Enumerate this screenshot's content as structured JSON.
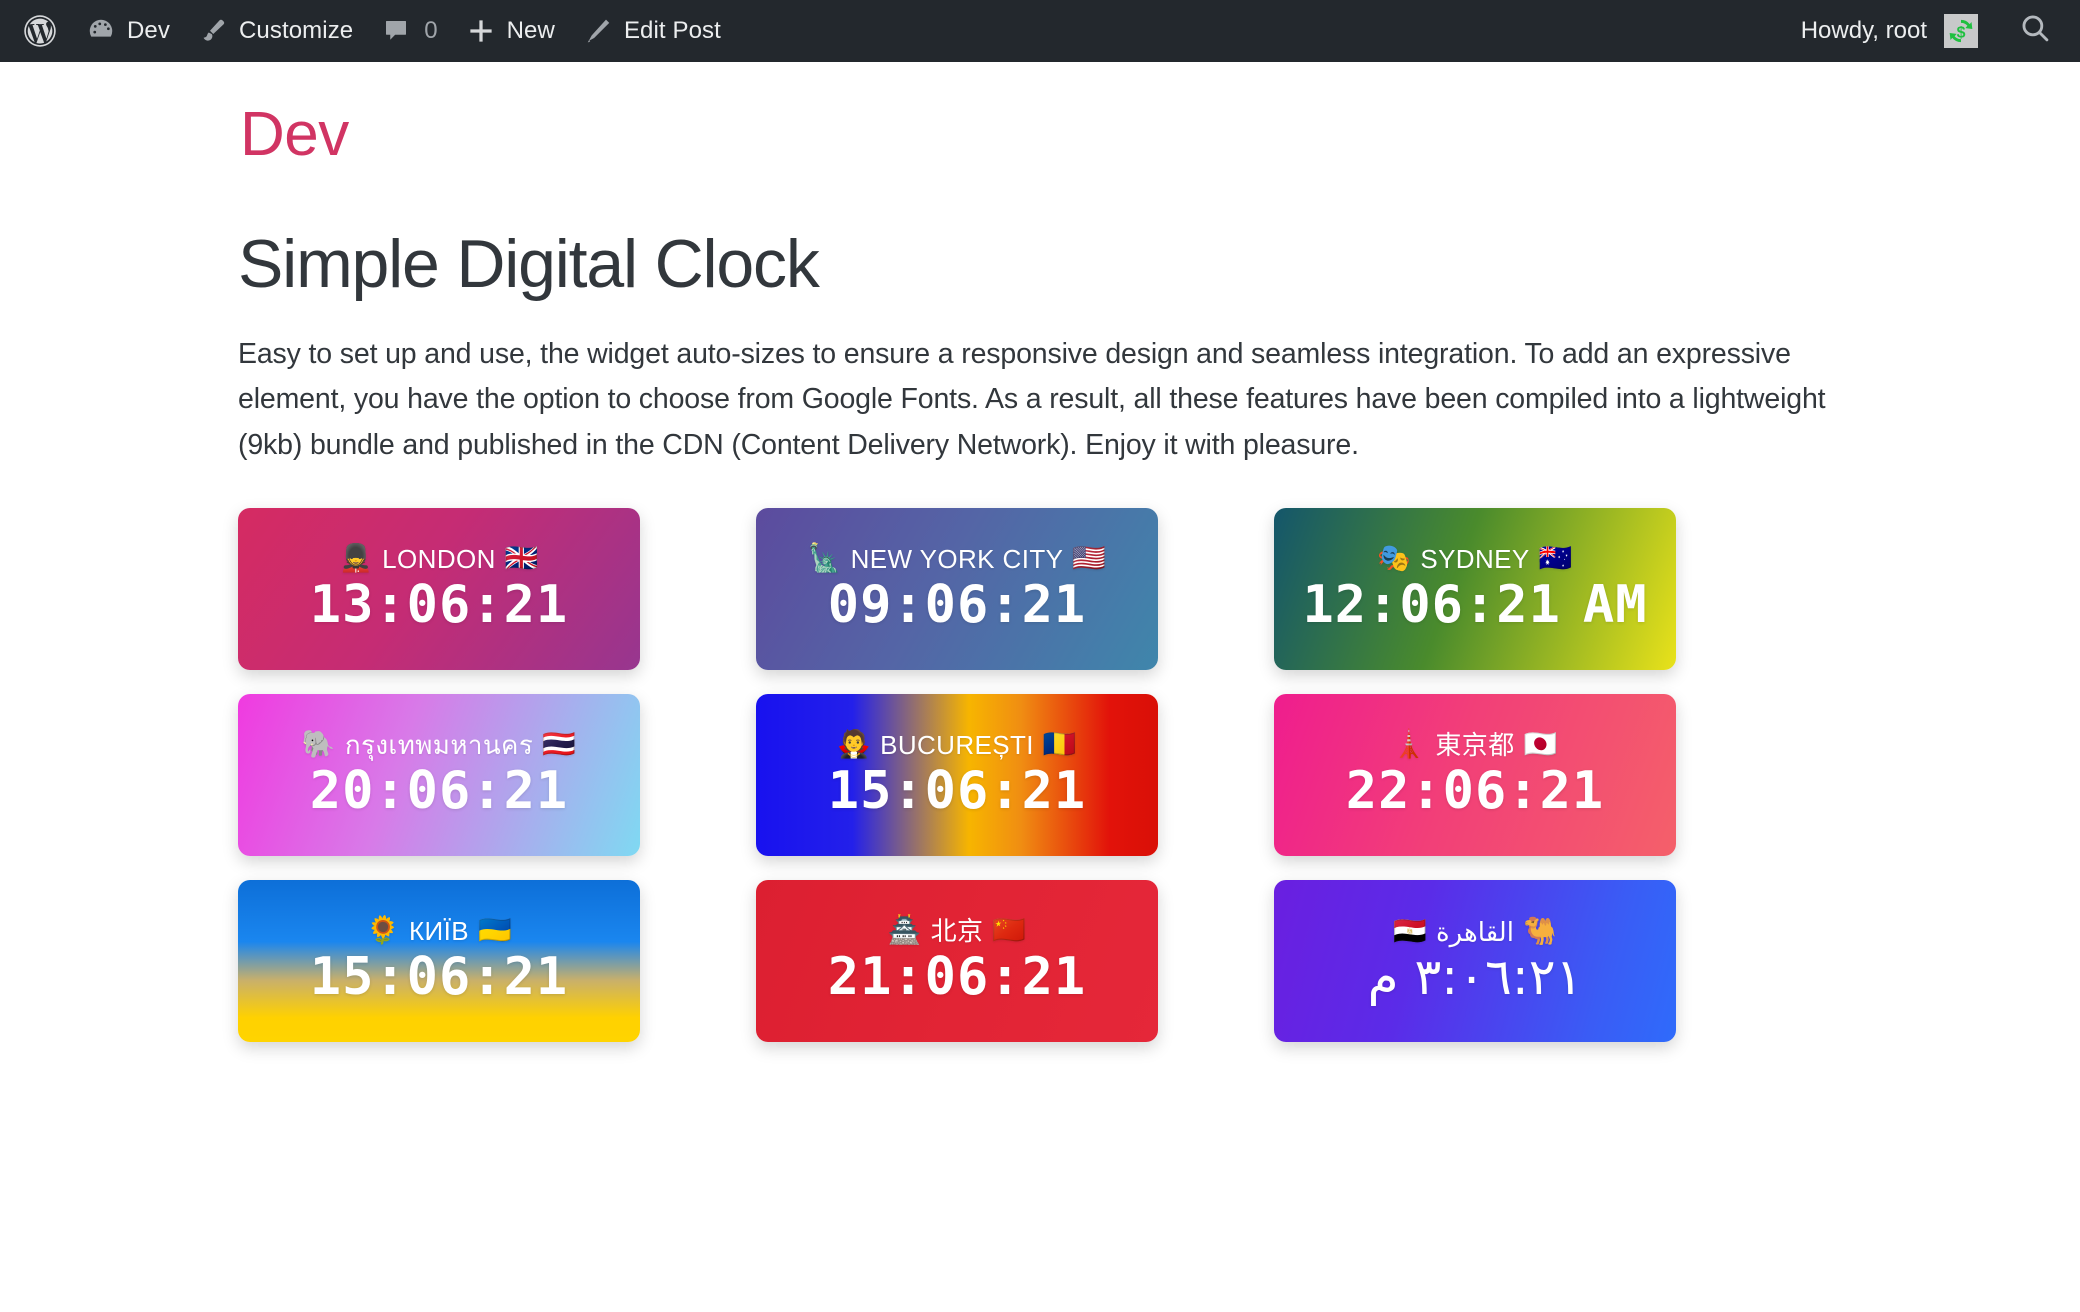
{
  "adminbar": {
    "wp_logo_name": "wordpress-logo-icon",
    "site_name": "Dev",
    "customize_label": "Customize",
    "comments_count": "0",
    "new_label": "New",
    "edit_post_label": "Edit Post",
    "howdy": "Howdy, root",
    "search_name": "search-icon"
  },
  "site": {
    "title": "Dev"
  },
  "post": {
    "title": "Simple Digital Clock",
    "description": "Easy to set up and use, the widget auto-sizes to ensure a responsive design and seamless integration. To add an expressive element, you have the option to choose from Google Fonts. As a result, all these features have been compiled into a lightweight (9kb) bundle and published in the CDN (Content Delivery Network). Enjoy it with pleasure."
  },
  "clocks": [
    {
      "id": "london",
      "emoji": "💂",
      "city": "LONDON",
      "flag": "🇬🇧",
      "time": "13:06:21",
      "ampm": "",
      "gradient_class": "g-london",
      "colors": [
        "#d52b62",
        "#97368f"
      ]
    },
    {
      "id": "new-york-city",
      "emoji": "🗽",
      "city": "NEW YORK CITY",
      "flag": "🇺🇸",
      "time": "09:06:21",
      "ampm": "",
      "gradient_class": "g-newyork",
      "colors": [
        "#5c4b9e",
        "#3f86ab"
      ]
    },
    {
      "id": "sydney",
      "emoji": "🎭",
      "city": "SYDNEY",
      "flag": "🇦🇺",
      "time": "12:06:21",
      "ampm": "AM",
      "gradient_class": "g-sydney",
      "colors": [
        "#14566b",
        "#e9e21a"
      ]
    },
    {
      "id": "bangkok",
      "emoji": "🐘",
      "city": "กรุงเทพมหานคร",
      "flag": "🇹🇭",
      "time": "20:06:21",
      "ampm": "",
      "gradient_class": "g-bangkok",
      "colors": [
        "#f03ae0",
        "#7fd9f2"
      ]
    },
    {
      "id": "bucuresti",
      "emoji": "🧛",
      "city": "BUCUREȘTI",
      "flag": "🇷🇴",
      "time": "15:06:21",
      "ampm": "",
      "gradient_class": "g-bucharest",
      "colors": [
        "#1811ef",
        "#f7b500",
        "#e2120a"
      ]
    },
    {
      "id": "tokyo",
      "emoji": "🗼",
      "city": "東京都",
      "flag": "🇯🇵",
      "time": "22:06:21",
      "ampm": "",
      "gradient_class": "g-tokyo",
      "colors": [
        "#ef1d8e",
        "#f4606a"
      ]
    },
    {
      "id": "kyiv",
      "emoji": "🌻",
      "city": "КИЇВ",
      "flag": "🇺🇦",
      "time": "15:06:21",
      "ampm": "",
      "gradient_class": "g-kyiv",
      "colors": [
        "#0d6fd8",
        "#ffd100"
      ]
    },
    {
      "id": "beijing",
      "emoji": "🏯",
      "city": "北京",
      "flag": "🇨🇳",
      "time": "21:06:21",
      "ampm": "",
      "gradient_class": "g-beijing",
      "colors": [
        "#dc1f31",
        "#e52739"
      ]
    },
    {
      "id": "cairo",
      "emoji": "🐫",
      "city": "القاهرة",
      "flag": "🇪🇬",
      "time": "٣:٠٦:٢١ م",
      "ampm": "",
      "gradient_class": "g-cairo",
      "colors": [
        "#6a1fe0",
        "#2f6bfb"
      ],
      "rtl": true
    }
  ]
}
